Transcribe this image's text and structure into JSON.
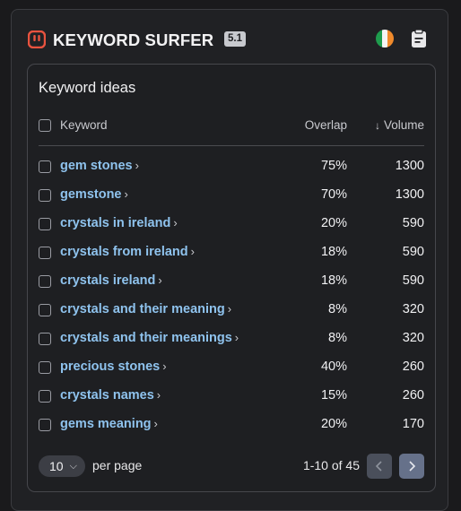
{
  "header": {
    "title": "KEYWORD SURFER",
    "version": "5.1",
    "logo_icon": "surfer-logo-icon",
    "country_icon": "ireland-flag-icon",
    "notes_icon": "notes-icon",
    "colors": {
      "accent": "#e8533f",
      "flag": [
        "#1e9c4d",
        "#f4f4f4",
        "#f08a2b"
      ]
    }
  },
  "card": {
    "title": "Keyword ideas",
    "columns": {
      "keyword": "Keyword",
      "overlap": "Overlap",
      "volume": "Volume",
      "volume_sort": "↓"
    },
    "rows": [
      {
        "keyword": "gem stones",
        "overlap": "75%",
        "volume": "1300"
      },
      {
        "keyword": "gemstone",
        "overlap": "70%",
        "volume": "1300"
      },
      {
        "keyword": "crystals in ireland",
        "overlap": "20%",
        "volume": "590"
      },
      {
        "keyword": "crystals from ireland",
        "overlap": "18%",
        "volume": "590"
      },
      {
        "keyword": "crystals ireland",
        "overlap": "18%",
        "volume": "590"
      },
      {
        "keyword": "crystals and their meaning",
        "overlap": "8%",
        "volume": "320"
      },
      {
        "keyword": "crystals and their meanings",
        "overlap": "8%",
        "volume": "320"
      },
      {
        "keyword": "precious stones",
        "overlap": "40%",
        "volume": "260"
      },
      {
        "keyword": "crystals names",
        "overlap": "15%",
        "volume": "260"
      },
      {
        "keyword": "gems meaning",
        "overlap": "20%",
        "volume": "170"
      }
    ],
    "footer": {
      "per_page_value": "10",
      "per_page_label": "per page",
      "range": "1-10 of 45",
      "prev_icon": "chevron-left-icon",
      "next_icon": "chevron-right-icon"
    }
  }
}
